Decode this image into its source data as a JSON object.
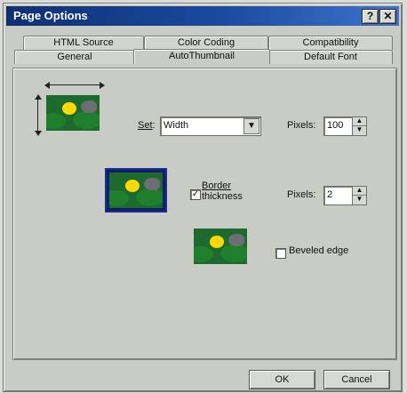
{
  "window": {
    "title": "Page Options",
    "help": "?",
    "close": "✕"
  },
  "tabs": {
    "row1": [
      "HTML Source",
      "Color Coding",
      "Compatibility"
    ],
    "row2": [
      "General",
      "AutoThumbnail",
      "Default Font"
    ]
  },
  "settings": {
    "set_label": "Set",
    "set_value": "Width",
    "pixels_label1": "Pixels:",
    "pixels_value1": "100",
    "border_label": "Border",
    "border_label2": "thickness",
    "pixels_label2": "Pixels:",
    "pixels_value2": "2",
    "beveled_label": "Beveled edge"
  },
  "buttons": {
    "ok": "OK",
    "cancel": "Cancel"
  },
  "icons": {
    "dropdown": "chevron-down-icon",
    "spin_up": "arrow-up-icon",
    "spin_down": "arrow-down-icon",
    "checkmark": "check-icon"
  }
}
